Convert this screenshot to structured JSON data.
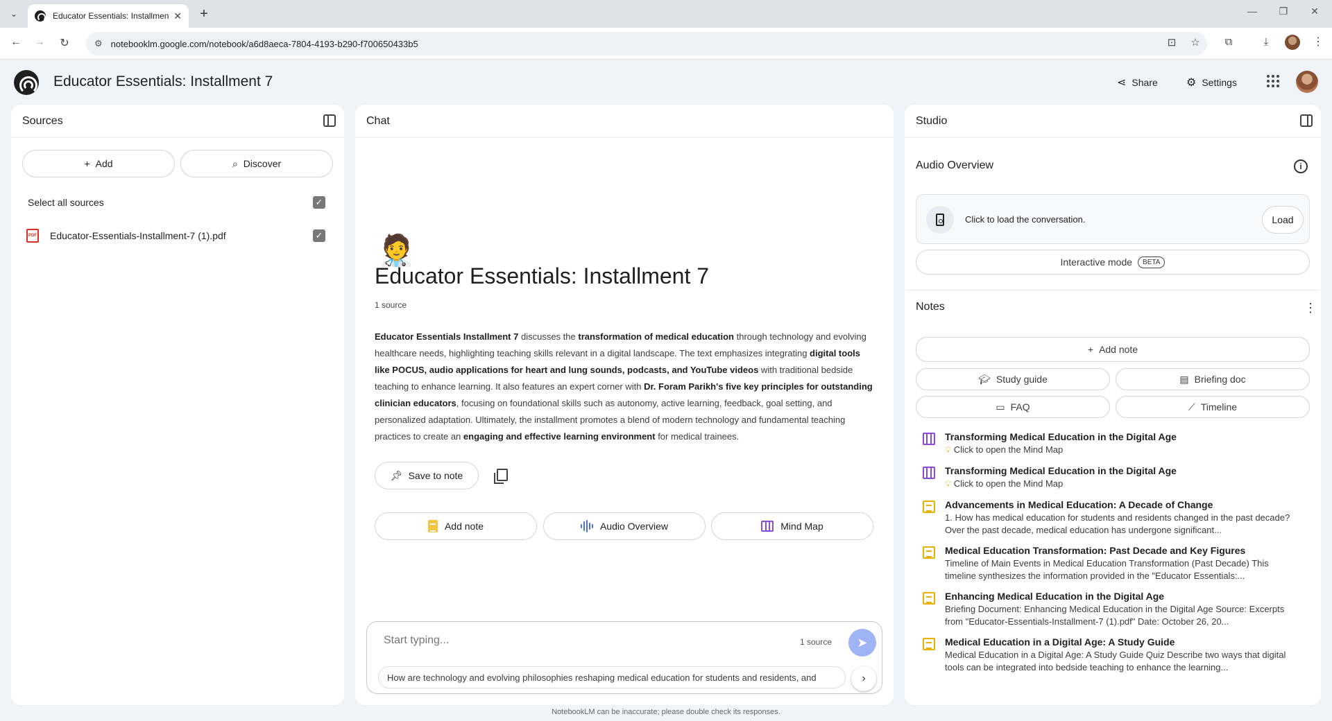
{
  "browser": {
    "tab_title": "Educator Essentials: Installment 7",
    "url": "notebooklm.google.com/notebook/a6d8aeca-7804-4193-b290-f700650433b5"
  },
  "app": {
    "title": "Educator Essentials: Installment 7",
    "share_label": "Share",
    "settings_label": "Settings"
  },
  "sources": {
    "header": "Sources",
    "add_label": "Add",
    "discover_label": "Discover",
    "select_all_label": "Select all sources",
    "items": [
      {
        "name": "Educator-Essentials-Installment-7 (1).pdf",
        "type": "pdf",
        "checked": true
      }
    ]
  },
  "chat": {
    "header": "Chat",
    "emoji": "🧑‍⚕️",
    "notebook_title": "Educator Essentials: Installment 7",
    "source_count": "1 source",
    "summary_segments": [
      {
        "text": "Educator Essentials Installment 7",
        "bold": true
      },
      {
        "text": " discusses the ",
        "bold": false
      },
      {
        "text": "transformation of medical education",
        "bold": true
      },
      {
        "text": " through technology and evolving healthcare needs, highlighting teaching skills relevant in a digital landscape. The text emphasizes integrating ",
        "bold": false
      },
      {
        "text": "digital tools like POCUS, audio applications for heart and lung sounds, podcasts, and YouTube videos",
        "bold": true
      },
      {
        "text": " with traditional bedside teaching to enhance learning. It also features an expert corner with ",
        "bold": false
      },
      {
        "text": "Dr. Foram Parikh's five key principles for outstanding clinician educators",
        "bold": true
      },
      {
        "text": ", focusing on foundational skills such as autonomy, active learning, feedback, goal setting, and personalized adaptation. Ultimately, the installment promotes a blend of modern technology and fundamental teaching practices to create an ",
        "bold": false
      },
      {
        "text": "engaging and effective learning environment",
        "bold": true
      },
      {
        "text": " for medical trainees.",
        "bold": false
      }
    ],
    "save_to_note_label": "Save to note",
    "actions": {
      "add_note": "Add note",
      "audio_overview": "Audio Overview",
      "mind_map": "Mind Map"
    },
    "input_placeholder": "Start typing...",
    "input_source_count": "1 source",
    "suggestion": "How are technology and evolving philosophies reshaping medical education for students and residents, and"
  },
  "studio": {
    "header": "Studio",
    "audio_overview_label": "Audio Overview",
    "audio_card_text": "Click to load the conversation.",
    "load_label": "Load",
    "interactive_mode_label": "Interactive mode",
    "beta_label": "BETA",
    "notes_label": "Notes",
    "add_note_label": "Add note",
    "study_guide_label": "Study guide",
    "briefing_doc_label": "Briefing doc",
    "faq_label": "FAQ",
    "timeline_label": "Timeline",
    "notes": [
      {
        "type": "mind-map",
        "title": "Transforming Medical Education in the Digital Age",
        "desc": "Click to open the Mind Map"
      },
      {
        "type": "mind-map",
        "title": "Transforming Medical Education in the Digital Age",
        "desc": "Click to open the Mind Map"
      },
      {
        "type": "doc",
        "title": "Advancements in Medical Education: A Decade of Change",
        "desc": "1. How has medical education for students and residents changed in the past decade? Over the past decade, medical education has undergone significant..."
      },
      {
        "type": "doc",
        "title": "Medical Education Transformation: Past Decade and Key Figures",
        "desc": "Timeline of Main Events in Medical Education Transformation (Past Decade) This timeline synthesizes the information provided in the \"Educator Essentials:..."
      },
      {
        "type": "doc",
        "title": "Enhancing Medical Education in the Digital Age",
        "desc": "Briefing Document: Enhancing Medical Education in the Digital Age Source: Excerpts from \"Educator-Essentials-Installment-7 (1).pdf\" Date: October 26, 20..."
      },
      {
        "type": "doc",
        "title": "Medical Education in a Digital Age: A Study Guide",
        "desc": "Medical Education in a Digital Age: A Study Guide Quiz Describe two ways that digital tools can be integrated into bedside teaching to enhance the learning..."
      }
    ]
  },
  "footer": {
    "disclaimer": "NotebookLM can be inaccurate; please double check its responses."
  }
}
